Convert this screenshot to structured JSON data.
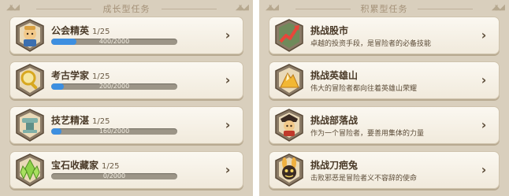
{
  "left_panel": {
    "title": "成长型任务",
    "items": [
      {
        "name": "公会精英",
        "count": "1/25",
        "progress_text": "400/2000",
        "progress": 0.2,
        "icon": "guild-emblem-icon"
      },
      {
        "name": "考古学家",
        "count": "1/25",
        "progress_text": "200/2000",
        "progress": 0.1,
        "icon": "magnifier-emblem-icon"
      },
      {
        "name": "技艺精湛",
        "count": "1/25",
        "progress_text": "160/2000",
        "progress": 0.08,
        "icon": "anvil-emblem-icon"
      },
      {
        "name": "宝石收藏家",
        "count": "1/25",
        "progress_text": "0/2000",
        "progress": 0,
        "icon": "gem-cluster-icon"
      }
    ]
  },
  "right_panel": {
    "title": "积累型任务",
    "items": [
      {
        "name": "挑战股市",
        "desc": "卓越的投资手段，是冒险者的必备技能",
        "icon": "stock-arrow-icon"
      },
      {
        "name": "挑战英雄山",
        "desc": "伟大的冒险者都向往着英雄山荣耀",
        "icon": "hero-mountain-icon"
      },
      {
        "name": "挑战部落战",
        "desc": "作为一个冒险者，要善用集体的力量",
        "icon": "tribe-warrior-icon"
      },
      {
        "name": "挑战刀疤兔",
        "desc": "击败邪恶是冒险者义不容辞的使命",
        "icon": "scar-rabbit-icon"
      }
    ]
  },
  "colors": {
    "panel_bg": "#d9cfbd",
    "card_bg": "#f7f2e7",
    "progress_fill": "#3d8fe0",
    "progress_track": "#9c9587",
    "title_text": "#4a3a28"
  }
}
